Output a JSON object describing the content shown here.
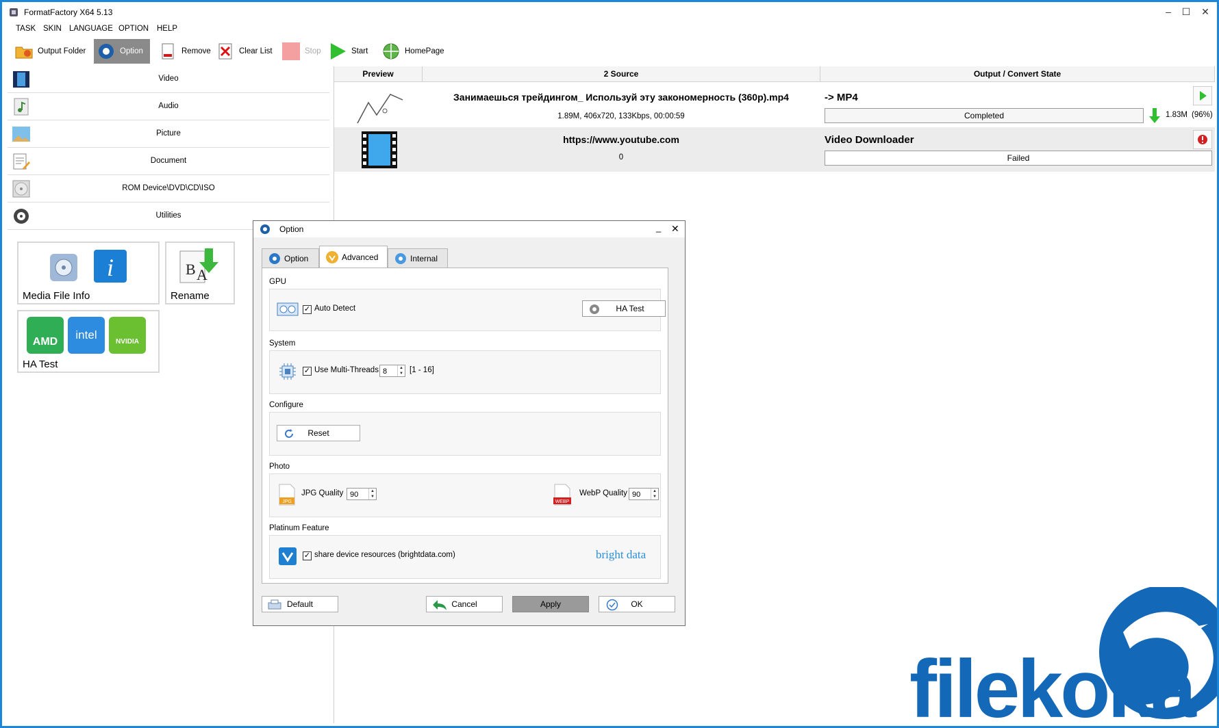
{
  "window": {
    "title": "FormatFactory X64 5.13"
  },
  "menu": [
    "TASK",
    "SKIN",
    "LANGUAGE",
    "OPTION",
    "HELP"
  ],
  "toolbar": {
    "output_folder": "Output Folder",
    "option": "Option",
    "remove": "Remove",
    "clear_list": "Clear List",
    "stop": "Stop",
    "start": "Start",
    "homepage": "HomePage"
  },
  "categories": [
    "Video",
    "Audio",
    "Picture",
    "Document",
    "ROM Device\\DVD\\CD\\ISO",
    "Utilities"
  ],
  "tools": {
    "media_file_info": "Media File Info",
    "rename": "Rename",
    "ha_test": "HA Test",
    "amd": "AMD",
    "intel": "intel",
    "nvidia": "NVIDIA"
  },
  "tasklist": {
    "columns": {
      "preview": "Preview",
      "source": "2 Source",
      "output": "Output / Convert State"
    },
    "rows": [
      {
        "source_name": "Занимаешься трейдингом_ Используй эту закономерность (360p).mp4",
        "source_info": "1.89M, 406x720, 133Kbps, 00:00:59",
        "output": "-> MP4",
        "state": "Completed",
        "result": "1.83M",
        "percent": "(96%)"
      },
      {
        "source_name": "https://www.youtube.com",
        "source_info": "0",
        "output": "Video Downloader",
        "state": "Failed"
      }
    ]
  },
  "dialog": {
    "title": "Option",
    "tabs": [
      "Option",
      "Advanced",
      "Internal"
    ],
    "selected_tab": "Advanced",
    "gpu": {
      "label": "GPU",
      "auto_detect": "Auto Detect",
      "auto_detect_checked": true,
      "ha_test": "HA Test"
    },
    "system": {
      "label": "System",
      "multi_threads": "Use Multi-Threads",
      "multi_threads_checked": true,
      "threads": "8",
      "range": "[1 - 16]"
    },
    "configure": {
      "label": "Configure",
      "reset": "Reset"
    },
    "photo": {
      "label": "Photo",
      "jpg_quality": "JPG Quality",
      "jpg_value": "90",
      "webp_quality": "WebP Quality",
      "webp_value": "90"
    },
    "platinum": {
      "label": "Platinum Feature",
      "share": "share device resources (brightdata.com)",
      "share_checked": true,
      "brand": "bright data"
    },
    "buttons": {
      "default": "Default",
      "cancel": "Cancel",
      "apply": "Apply",
      "ok": "OK"
    }
  },
  "watermark": {
    "text": "filekoka"
  }
}
